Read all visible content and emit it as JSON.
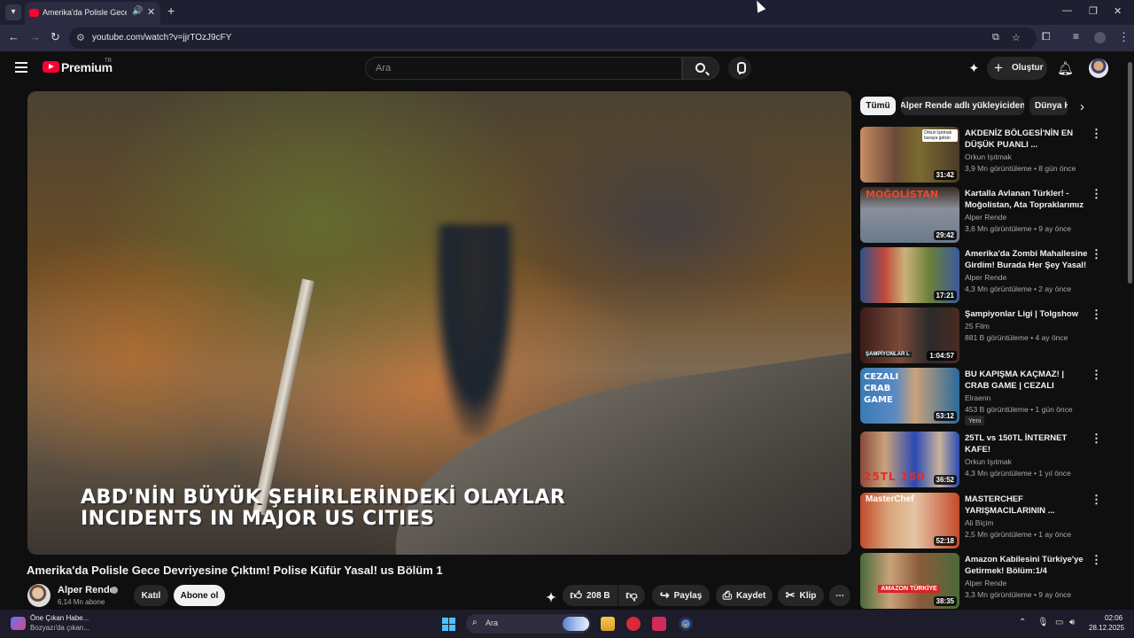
{
  "browser": {
    "tab_title": "Amerika'da Polisle Gece Devriyesine Çıktım! Polise Küfür Yasal! us Bölüm 1",
    "url": "youtube.com/watch?v=jjrTOzJ9cFY",
    "window_controls": [
      "—",
      "❐",
      "✕"
    ]
  },
  "header": {
    "logo_text": "Premium",
    "logo_country": "TR",
    "search_placeholder": "Ara",
    "create_label": "Oluştur"
  },
  "video": {
    "overlay_line1": "ABD'NİN BÜYÜK ŞEHİRLERİNDEKİ OLAYLAR",
    "overlay_line2": "INCIDENTS IN MAJOR US CITIES",
    "title": "Amerika'da Polisle Gece Devriyesine Çıktım! Polise Küfür Yasal! us Bölüm 1",
    "channel": "Alper Rende",
    "subscribers": "6,14 Mn abone",
    "join_label": "Katıl",
    "subscribe_label": "Abone ol",
    "likes": "208 B",
    "share_label": "Paylaş",
    "save_label": "Kaydet",
    "clip_label": "Klip"
  },
  "chips": [
    "Tümü",
    "Alper Rende adlı yükleyiciden",
    "Dünya H"
  ],
  "recommendations": [
    {
      "title": "AKDENİZ BÖLGESİ'NİN EN DÜŞÜK PUANLI ...",
      "channel": "Orkun Işıtmak",
      "meta": "3,9 Mn görüntüleme • 8 gün önce",
      "duration": "31:42",
      "thumb_text": "Orkun Işıtmak buraya gelsin"
    },
    {
      "title": "Kartalla Avlanan Türkler! - Moğolistan, Ata Topraklarımız",
      "channel": "Alper Rende",
      "meta": "3,6 Mn görüntüleme • 9 ay önce",
      "duration": "29:42",
      "thumb_text": "MOĞOLİSTAN"
    },
    {
      "title": "Amerika'da Zombi Mahallesine Girdim! Burada Her Şey Yasal! ...",
      "channel": "Alper Rende",
      "meta": "4,3 Mn görüntüleme • 2 ay önce",
      "duration": "17:21",
      "thumb_text": ""
    },
    {
      "title": "Şampiyonlar Ligi | Tolgshow",
      "channel": "25 Film",
      "meta": "881 B görüntüleme • 4 ay önce",
      "duration": "1:04:57",
      "thumb_text": "ŞAMPİYONLAR L"
    },
    {
      "title": "BU KAPIŞMA KAÇMAZ! | CRAB GAME | CEZALI",
      "channel": "Elraenn",
      "meta": "453 B görüntüleme • 1 gün önce",
      "duration": "53:12",
      "badge": "Yeni",
      "thumb_text": "CEZALI CRAB GAME"
    },
    {
      "title": "25TL vs 150TL İNTERNET KAFE!",
      "channel": "Orkun Işıtmak",
      "meta": "4,3 Mn görüntüleme • 1 yıl önce",
      "duration": "36:52",
      "thumb_text": "25TL 150"
    },
    {
      "title": "MASTERCHEF YARIŞMACILARININ ...",
      "channel": "Ali Biçim",
      "meta": "2,5 Mn görüntüleme • 1 ay önce",
      "duration": "52:18",
      "thumb_text": "MasterChef"
    },
    {
      "title": "Amazon Kabilesini Türkiye'ye Getirmek! Bölüm:1/4",
      "channel": "Alper Rende",
      "meta": "3,3 Mn görüntüleme • 9 ay önce",
      "duration": "38:35",
      "thumb_text": "AMAZON TÜRKİYE"
    }
  ],
  "taskbar": {
    "news_title": "Öne Çıkan Habe...",
    "news_sub": "Bozyazı'da çıkan...",
    "search_label": "Ara",
    "time": "02:06",
    "date": "28.12.2025"
  },
  "colors": {
    "brand_red": "#ff0033",
    "background": "#0f0f0f",
    "browser_chrome": "#2b2c41"
  }
}
